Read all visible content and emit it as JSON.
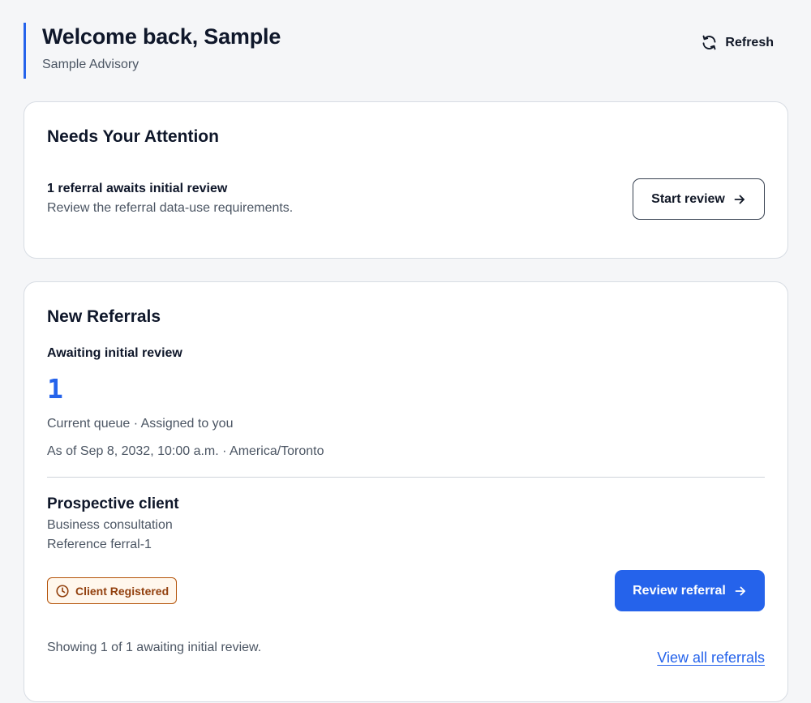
{
  "header": {
    "title": "Welcome back, Sample",
    "organization": "Sample Advisory",
    "refresh_label": "Refresh"
  },
  "attention": {
    "title": "Needs Your Attention",
    "item_title": "1 referral awaits initial review",
    "item_description": "Review the referral data-use requirements.",
    "action_label": "Start review"
  },
  "referrals": {
    "title": "New Referrals",
    "awaiting_label": "Awaiting initial review",
    "count": "1",
    "queue_text": "Current queue · Assigned to you",
    "as_of_text": "As of Sep 8, 2032, 10:00 a.m. · America/Toronto",
    "client": {
      "title": "Prospective client",
      "type": "Business consultation",
      "reference": "Reference ferral-1",
      "status_badge": "Client Registered"
    },
    "review_button_label": "Review referral",
    "showing_text": "Showing 1 of 1 awaiting initial review.",
    "view_all_label": "View all referrals"
  },
  "colors": {
    "accent": "#2563eb",
    "badge_border": "#b45309",
    "badge_text": "#92400e"
  },
  "icons": {
    "refresh": "refresh-icon",
    "arrow": "arrow-right-icon",
    "clock": "clock-icon"
  }
}
